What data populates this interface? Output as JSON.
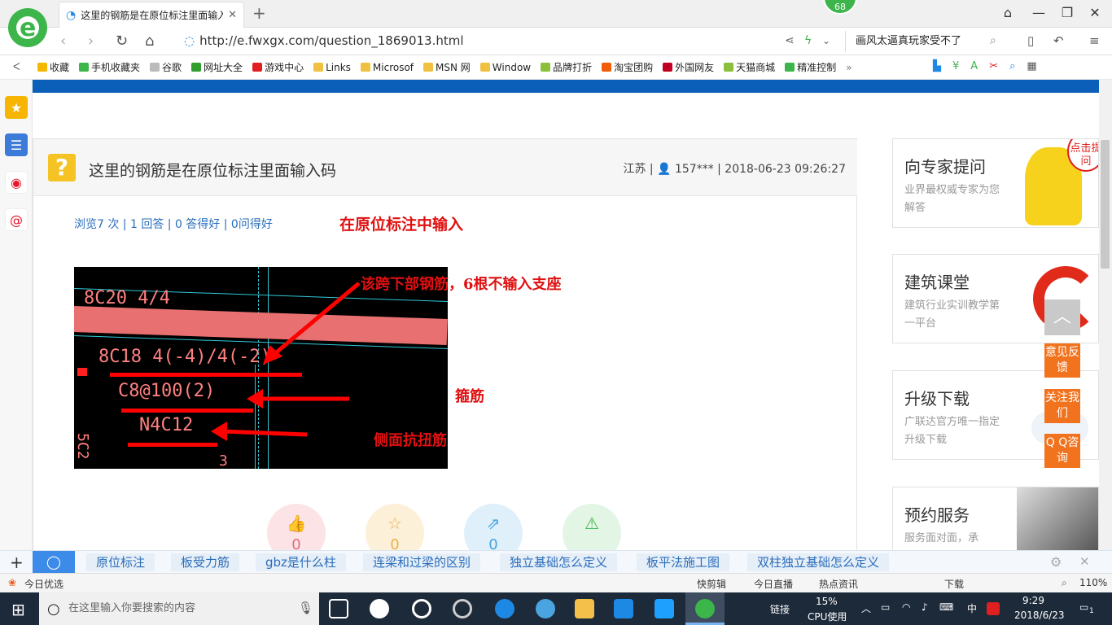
{
  "browser": {
    "tab_title": "这里的钢筋是在原位标注里面输入码",
    "badge_count": "68",
    "url": "http://e.fwxgx.com/question_1869013.html",
    "search_text": "画风太逼真玩家受不了",
    "bookmarks": [
      {
        "label": "收藏",
        "color": "#f5b800"
      },
      {
        "label": "手机收藏夹",
        "color": "#3cb54a"
      },
      {
        "label": "谷歌",
        "color": "#bbbbbb"
      },
      {
        "label": "网址大全",
        "color": "#2f9e2f"
      },
      {
        "label": "游戏中心",
        "color": "#e02020"
      },
      {
        "label": "Links",
        "color": "#f0c040"
      },
      {
        "label": "Microsof",
        "color": "#f0c040"
      },
      {
        "label": "MSN 网",
        "color": "#f0c040"
      },
      {
        "label": "Window",
        "color": "#f0c040"
      },
      {
        "label": "品牌打折",
        "color": "#8ac03c"
      },
      {
        "label": "淘宝团购",
        "color": "#f25c05"
      },
      {
        "label": "外国网友",
        "color": "#c00020"
      },
      {
        "label": "天猫商城",
        "color": "#8ac03c"
      },
      {
        "label": "精准控制",
        "color": "#3cb54a"
      }
    ]
  },
  "question": {
    "title": "这里的钢筋是在原位标注里面输入码",
    "meta": "江苏 | 👤 157*** | 2018-06-23 09:26:27",
    "stats": "浏览7 次 | 1 回答 | 0 答得好 | 0问得好",
    "annotation_top": "在原位标注中输入",
    "cad_texts": {
      "t1": "8C20 4/4",
      "t2": "8C18 4(-4)/4(-2)",
      "t3": "C8@100(2)",
      "t4": "N4C12",
      "t5": "5C2",
      "t6": "3"
    },
    "label_bottom_rebar": "该跨下部钢筋，6根不输入支座",
    "label_stirrup": "箍筋",
    "label_torsion": "侧面抗扭筋",
    "actions": [
      {
        "name": "like",
        "count": "0",
        "bg": "#fbe3e6",
        "fg": "#e56b7e"
      },
      {
        "name": "favorite",
        "count": "0",
        "bg": "#fdf0d9",
        "fg": "#e9b04a"
      },
      {
        "name": "share",
        "count": "0",
        "bg": "#dff0fb",
        "fg": "#4aa4e0"
      },
      {
        "name": "report",
        "count": "",
        "bg": "#e3f5e5",
        "fg": "#3cb54a"
      }
    ]
  },
  "sidebar": {
    "cards": [
      {
        "title": "向专家提问",
        "sub": "业界最权威专家为您解答",
        "bubble": "点击提问"
      },
      {
        "title": "建筑课堂",
        "sub": "建筑行业实训教学第一平台"
      },
      {
        "title": "升级下载",
        "sub": "广联达官方唯一指定升级下载"
      },
      {
        "title": "预约服务",
        "sub": "服务面对面，承"
      }
    ],
    "float_buttons": [
      "意见反馈",
      "关注我们",
      "Q Q咨询"
    ]
  },
  "hot_words": [
    "原位标注",
    "板受力筋",
    "gbz是什么柱",
    "连梁和过梁的区别",
    "独立基础怎么定义",
    "板平法施工图",
    "双柱独立基础怎么定义"
  ],
  "statusbar": {
    "left": "今日优选",
    "items": [
      "快剪辑",
      "今日直播",
      "热点资讯",
      "下载"
    ],
    "zoom": "110%"
  },
  "taskbar": {
    "search_placeholder": "在这里输入你要搜索的内容",
    "link_label": "链接",
    "cpu_percent": "15%",
    "cpu_label": "CPU使用",
    "ime": "中",
    "time": "9:29",
    "date": "2018/6/23",
    "notif_count": "1"
  }
}
